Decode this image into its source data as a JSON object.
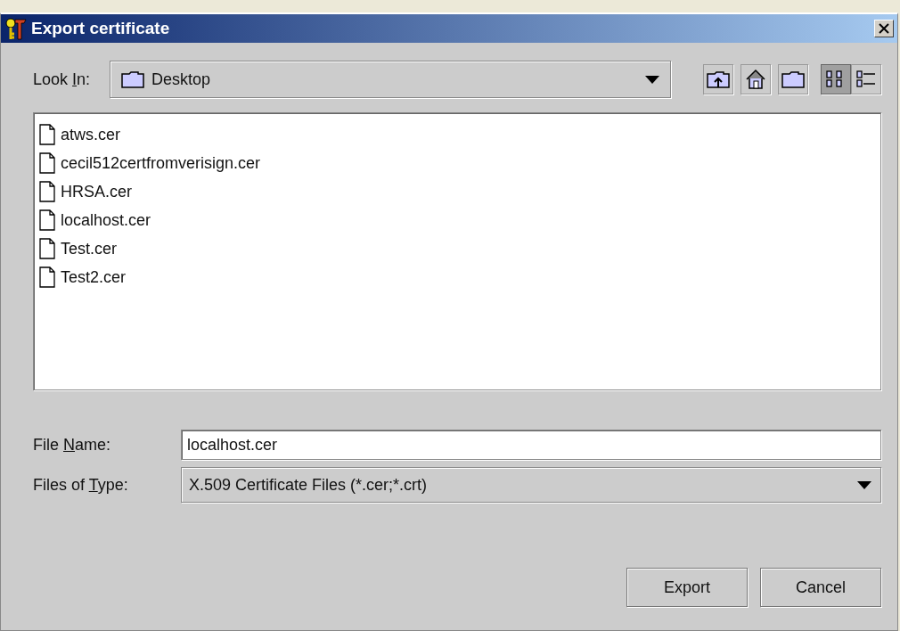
{
  "window": {
    "title": "Export certificate"
  },
  "look_in": {
    "label": [
      "Look ",
      "I",
      "n:"
    ],
    "value": "Desktop"
  },
  "toolbar": [
    {
      "kind": "up"
    },
    {
      "kind": "home"
    },
    {
      "kind": "new-folder"
    },
    {
      "kind": "list-view",
      "selected": true
    },
    {
      "kind": "details-view",
      "selected": false
    }
  ],
  "files": [
    {
      "name": "atws.cer",
      "selected": false
    },
    {
      "name": "cecil512certfromverisign.cer",
      "selected": false
    },
    {
      "name": "HRSA.cer",
      "selected": false
    },
    {
      "name": "localhost.cer",
      "selected": false
    },
    {
      "name": "Test.cer",
      "selected": false
    },
    {
      "name": "Test2.cer",
      "selected": false
    }
  ],
  "file_name": {
    "label": [
      "File ",
      "N",
      "ame:"
    ],
    "value": "localhost.cer"
  },
  "file_type": {
    "label": [
      "Files of ",
      "T",
      "ype:"
    ],
    "value": "X.509 Certificate Files (*.cer;*.crt)"
  },
  "buttons": [
    "Export",
    "Cancel"
  ]
}
